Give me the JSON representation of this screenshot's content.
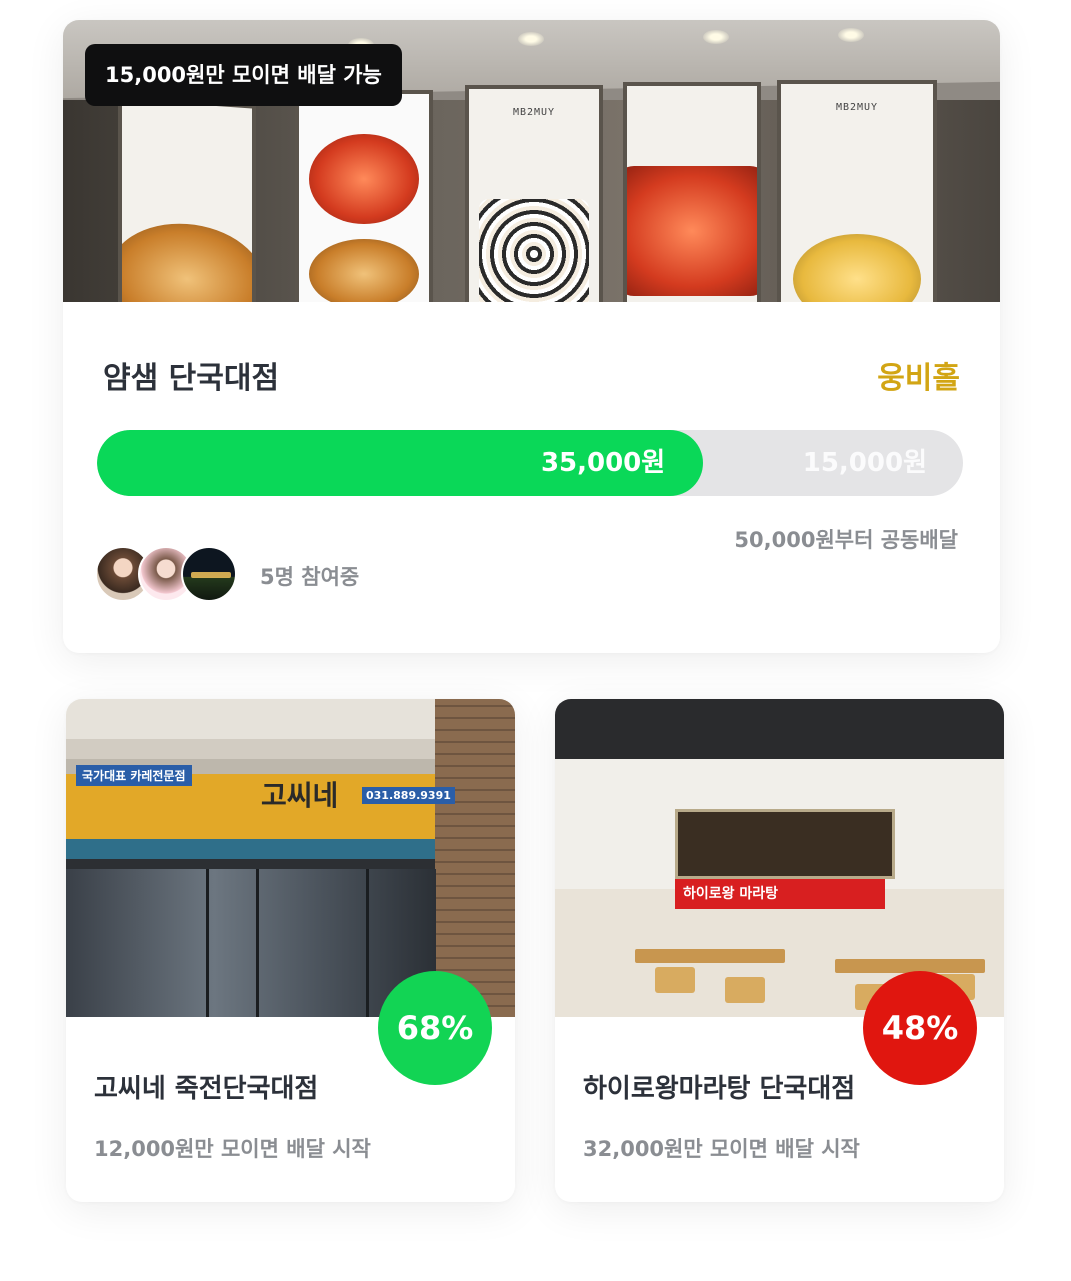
{
  "featured": {
    "goal_pill": "15,000원만 모이면 배달 가능",
    "store_name": "얌샘 단국대점",
    "area": "웅비홀",
    "progress": {
      "collected_label": "35,000원",
      "remaining_label": "15,000원",
      "fraction": 0.7
    },
    "threshold_text": "50,000원부터 공동배달",
    "participants_text": "5명 참여중",
    "banner_texts": [
      "MB2MUY",
      "MB2MUY"
    ],
    "colors": {
      "progress_fill": "#0ad858",
      "area": "#d2a514"
    }
  },
  "cards": [
    {
      "percent": "68%",
      "title": "고씨네 죽전단국대점",
      "subtitle": "12,000원만 모이면 배달 시작",
      "badge_color": "#12d454",
      "sign_left": "국가대표 카레전문점",
      "sign_brand": "고씨네",
      "sign_phone": "031.889.9391"
    },
    {
      "percent": "48%",
      "title": "하이로왕마라탕 단국대점",
      "subtitle": "32,000원만 모이면 배달 시작",
      "badge_color": "#e0160f",
      "banner_text": "하이로왕 마라탕"
    }
  ]
}
